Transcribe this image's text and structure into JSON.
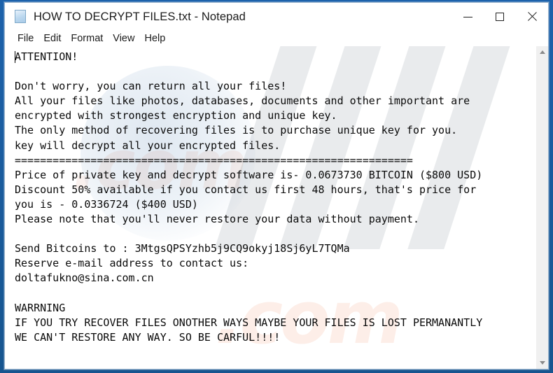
{
  "window": {
    "title": "HOW TO DECRYPT FILES.txt - Notepad",
    "icon": "notepad-document-icon",
    "controls": {
      "minimize_label": "Minimize",
      "maximize_label": "Maximize",
      "close_label": "Close"
    },
    "frame_color": "#1d62ab",
    "background_color": "#ffffff"
  },
  "menubar": {
    "items": [
      {
        "label": "File"
      },
      {
        "label": "Edit"
      },
      {
        "label": "Format"
      },
      {
        "label": "View"
      },
      {
        "label": "Help"
      }
    ]
  },
  "editor": {
    "font": "monospace",
    "text_color": "#0a0a0a",
    "caret_visible": true,
    "content": "ATTENTION!\n\nDon't worry, you can return all your files!\nAll your files like photos, databases, documents and other important are\nencrypted with strongest encryption and unique key.\nThe only method of recovering files is to purchase unique key for you.\nkey will decrypt all your encrypted files.\n===============================================================\nPrice of private key and decrypt software is- 0.0673730 BITCOIN ($800 USD)\nDiscount 50% available if you contact us first 48 hours, that's price for\nyou is - 0.0336724 ($400 USD)\nPlease note that you'll never restore your data without payment.\n\nSend Bitcoins to : 3MtgsQPSYzhb5j9CQ9okyj18Sj6yL7TQMa\nReserve e-mail address to contact us:\ndoltafukno@sina.com.cn\n\nWARRNING\nIF YOU TRY RECOVER FILES ONOTHER WAYS MAYBE YOUR FILES IS LOST PERMANANTLY\nWE CAN'T RESTORE ANY WAY. SO BE CARFUL!!!!",
    "ransom_details": {
      "headline": "ATTENTION!",
      "bitcoin_price_full": "0.0673730 BITCOIN",
      "usd_price_full": "$800 USD",
      "discount_percent": "50%",
      "discount_window_hours": "48 hours",
      "bitcoin_price_discount": "0.0336724",
      "usd_price_discount": "$400 USD",
      "bitcoin_address": "3MtgsQPSYzhb5j9CQ9okyj18Sj6yL7TQMa",
      "email": "doltafukno@sina.com.cn",
      "warning_title": "WARRNING"
    }
  },
  "scrollbar": {
    "up_arrow": "scroll-up-arrow-icon",
    "down_arrow": "scroll-down-arrow-icon"
  },
  "watermark": {
    "text": ".com"
  }
}
